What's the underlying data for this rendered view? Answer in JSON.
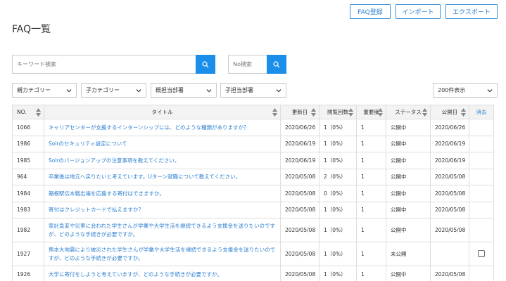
{
  "header": {
    "title": "FAQ一覧",
    "buttons": {
      "register": "FAQ登録",
      "import": "インポート",
      "export": "エクスポート"
    }
  },
  "search": {
    "keyword_placeholder": "キーワード検索",
    "no_placeholder": "No検索"
  },
  "filters": {
    "parent_category": "親カテゴリー",
    "child_category": "子カテゴリー",
    "main_department": "概担当部署",
    "sub_department": "子担当部署",
    "per_page": "200件表示"
  },
  "table": {
    "headers": {
      "no": "NO.",
      "title": "タイトル",
      "updated": "更新日",
      "views": "閲覧回数",
      "priority": "重要度",
      "status": "ステータス",
      "published": "公開日",
      "clear": "消去"
    },
    "rows": [
      {
        "no": "1066",
        "title": "キャリアセンターが支援するインターンシップには、どのような種類がありますか？",
        "updated": "2020/06/26",
        "views": "1（0%）",
        "priority": "1",
        "status": "公開中",
        "published": "2020/06/26"
      },
      {
        "no": "1986",
        "title": "Solrのセキュリティ設定について",
        "updated": "2020/06/19",
        "views": "1（0%）",
        "priority": "1",
        "status": "公開中",
        "published": "2020/06/19"
      },
      {
        "no": "1985",
        "title": "Solrのバージョンアップの注意事項を教えてください。",
        "updated": "2020/06/19",
        "views": "1（0%）",
        "priority": "1",
        "status": "公開中",
        "published": "2020/06/19"
      },
      {
        "no": "964",
        "title": "卒業後は地元へ戻りたいと考えています。Uターン就職について教えてください。",
        "updated": "2020/05/08",
        "views": "2（0%）",
        "priority": "1",
        "status": "公開中",
        "published": "2020/05/08"
      },
      {
        "no": "1984",
        "title": "箱根駅伝本戦出場を応援する寄付はできますか。",
        "updated": "2020/05/08",
        "views": "0（0%）",
        "priority": "1",
        "status": "公開中",
        "published": "2020/05/08"
      },
      {
        "no": "1983",
        "title": "寄付はクレジットカードで払えますか？",
        "updated": "2020/05/08",
        "views": "1（0%）",
        "priority": "1",
        "status": "公開中",
        "published": "2020/05/08"
      },
      {
        "no": "1982",
        "title": "家計急変や災害に会われた学生さんが学業や大学生活を継続できるよう支援金を送りたいのですが、どのような手続きが必要ですか。",
        "updated": "2020/05/08",
        "views": "1（0%）",
        "priority": "1",
        "status": "公開中",
        "published": "2020/05/08"
      },
      {
        "no": "1927",
        "title": "熊本大地震により被災された学生さんが学業や大学生活を継続できるよう支援金を送りたいのですが、どのような手続きが必要ですか。",
        "updated": "2020/05/08",
        "views": "1（0%）",
        "priority": "1",
        "status": "未公開",
        "published": ""
      },
      {
        "no": "1926",
        "title": "大学に寄付をしようと考えていますが、どのような手続きが必要ですか。",
        "updated": "2020/05/08",
        "views": "1（0%）",
        "priority": "1",
        "status": "公開中",
        "published": "2020/05/08"
      }
    ]
  },
  "colors": {
    "accent": "#1a8ee8",
    "link": "#2d7fd0"
  }
}
